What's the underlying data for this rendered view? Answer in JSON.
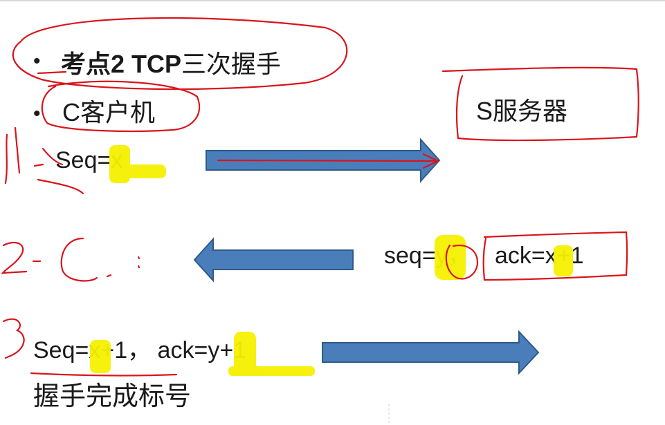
{
  "bullets": {
    "title_prefix": "考点2 ",
    "title_bold": "TCP",
    "title_suffix": "三次握手",
    "client": "C客户机"
  },
  "server_label": "S服务器",
  "steps": [
    {
      "text": "Seq=x"
    },
    {
      "text_seq": "seq=y，",
      "text_ack": "ack=x+1"
    },
    {
      "text": "Seq=x+1，  ack=y+1"
    }
  ],
  "footer_text": "握手完成标号",
  "colors": {
    "arrow_fill": "#4a7ebb",
    "arrow_stroke": "#2e5a8a",
    "ink_red": "#d9141c",
    "highlight": "#f5f000"
  }
}
